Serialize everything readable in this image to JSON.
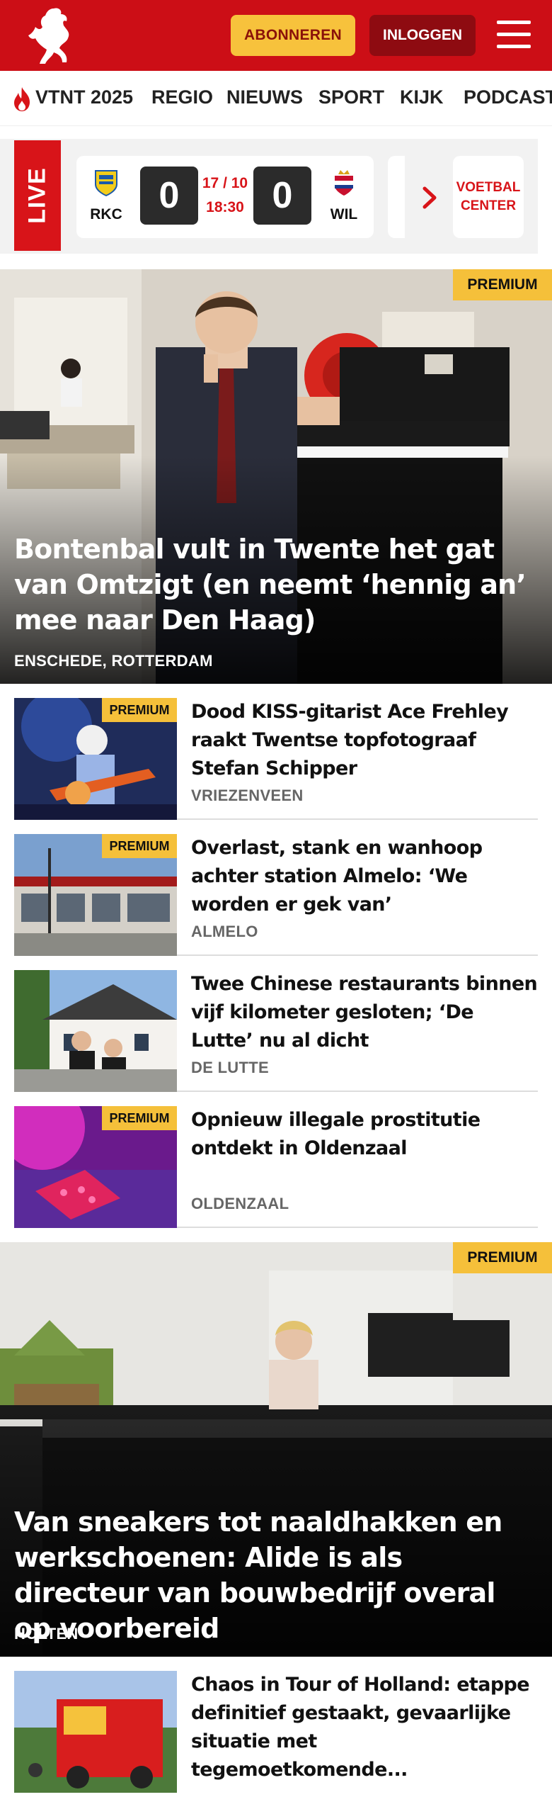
{
  "header": {
    "subscribe_label": "ABONNEREN",
    "login_label": "INLOGGEN"
  },
  "nav": {
    "items": [
      "VTNT 2025",
      "REGIO",
      "NIEUWS",
      "SPORT",
      "KIJK",
      "PODCAST"
    ]
  },
  "live": {
    "label": "LIVE",
    "match": {
      "home": "RKC",
      "away": "WIL",
      "home_score": "0",
      "away_score": "0",
      "date": "17 / 10",
      "time": "18:30"
    },
    "center_label": "VOETBAL CENTER"
  },
  "premium_label": "PREMIUM",
  "articles": [
    {
      "title": "Bontenbal vult in Twente het gat van Omtzigt (en neemt ‘hennig an’ mee naar Den Haag)",
      "location": "ENSCHEDE, ROTTERDAM",
      "premium": true
    },
    {
      "title": "Dood KISS-gitarist Ace Frehley raakt Twentse topfotograaf Stefan Schipper",
      "location": "VRIEZENVEEN",
      "premium": true
    },
    {
      "title": "Overlast, stank en wanhoop achter station Almelo: ‘We worden er gek van’",
      "location": "ALMELO",
      "premium": true
    },
    {
      "title": "Twee Chinese restaurants binnen vijf kilometer gesloten; ‘De Lutte’ nu al dicht",
      "location": "DE LUTTE",
      "premium": false
    },
    {
      "title": "Opnieuw illegale prostitutie ontdekt in Oldenzaal",
      "location": "OLDENZAAL",
      "premium": true
    },
    {
      "title": "Van sneakers tot naaldhakken en werkschoenen: Alide is als directeur van bouwbedrijf overal op voorbereid",
      "location": "HOLTEN",
      "premium": true
    },
    {
      "title": "Chaos in Tour of Holland: etappe definitief gestaakt, gevaarlijke situatie met tegemoetkomende...",
      "location": "",
      "premium": false
    }
  ],
  "colors": {
    "brand_red": "#cc0e16",
    "premium_yellow": "#f5c03a",
    "subscribe_yellow": "#f7c23c"
  }
}
